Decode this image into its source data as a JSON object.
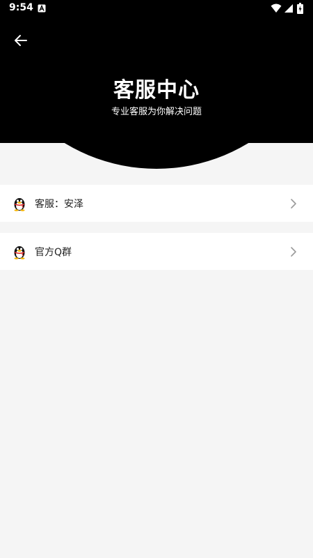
{
  "status_bar": {
    "time": "9:54"
  },
  "header": {
    "title": "客服中心",
    "subtitle": "专业客服为你解决问题"
  },
  "list": [
    {
      "label": "客服：安泽",
      "icon": "qq-penguin-icon"
    },
    {
      "label": "官方Q群",
      "icon": "qq-penguin-icon"
    }
  ],
  "colors": {
    "header_bg": "#000000",
    "page_bg": "#f5f5f5",
    "card_bg": "#ffffff",
    "qq_red": "#e02020",
    "qq_yellow": "#f5b400"
  }
}
